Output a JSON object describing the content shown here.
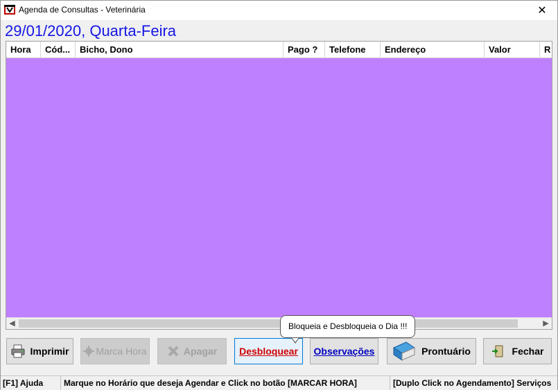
{
  "window": {
    "title": "Agenda de Consultas - Veterinária",
    "close_glyph": "✕"
  },
  "date_heading": "29/01/2020, Quarta-Feira",
  "grid": {
    "background_color": "#bf80ff",
    "columns": [
      "Hora",
      "Cód...",
      "Bicho, Dono",
      "Pago ?",
      "Telefone",
      "Endereço",
      "Valor",
      "R"
    ],
    "rows": []
  },
  "tooltip": {
    "text": "Bloqueia e Desbloqueia o Dia !!!"
  },
  "buttons": {
    "imprimir": {
      "label": "Imprimir",
      "icon": "printer-icon",
      "enabled": true
    },
    "marca_hora": {
      "label": "Marca Hora",
      "icon": "gear-icon",
      "enabled": false
    },
    "apagar": {
      "label": "Apagar",
      "icon": "delete-x-icon",
      "enabled": false
    },
    "desbloquear": {
      "label": "Desbloquear",
      "enabled": true,
      "color": "#d00000"
    },
    "observacoes": {
      "label": "Observações",
      "enabled": true,
      "color": "#0000c0"
    },
    "prontuario": {
      "label": "Prontuário",
      "icon": "book-icon",
      "enabled": true
    },
    "fechar": {
      "label": "Fechar",
      "icon": "exit-door-icon",
      "enabled": true
    }
  },
  "statusbar": {
    "help": "[F1] Ajuda",
    "instruction": "Marque no Horário que deseja Agendar e Click no botão [MARCAR HORA]",
    "hint": "[Duplo Click no Agendamento] Serviços"
  }
}
